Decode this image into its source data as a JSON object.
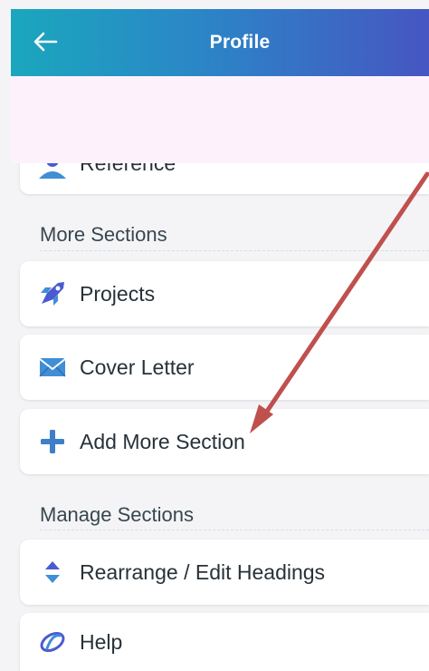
{
  "header": {
    "title": "Profile",
    "back_icon": "back-arrow-icon"
  },
  "colors": {
    "header_gradient_start": "#1aa7bd",
    "header_gradient_end": "#4656c2",
    "annotation_arrow": "#c0504d",
    "plus_icon": "#3e7fc8"
  },
  "items": {
    "reference": {
      "label": "Reference",
      "icon": "reference-icon"
    },
    "projects": {
      "label": "Projects",
      "icon": "rocket-icon"
    },
    "cover_letter": {
      "label": "Cover Letter",
      "icon": "envelope-icon"
    },
    "add_more": {
      "label": "Add More Section",
      "icon": "plus-icon"
    },
    "rearrange": {
      "label": "Rearrange / Edit Headings",
      "icon": "sort-arrows-icon"
    },
    "help": {
      "label": "Help",
      "icon": "help-icon"
    }
  },
  "sections": {
    "more": "More Sections",
    "manage": "Manage Sections"
  }
}
